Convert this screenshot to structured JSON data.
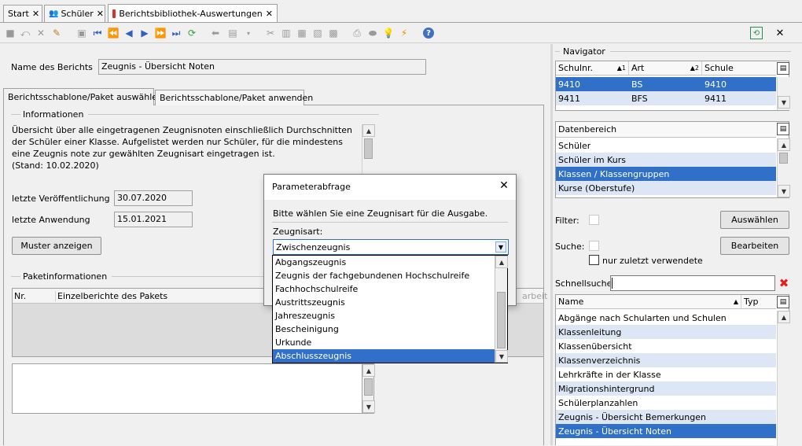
{
  "tabs": [
    {
      "label": "Start"
    },
    {
      "label": "Schüler"
    },
    {
      "label": "Berichtsbibliothek-Auswertungen"
    }
  ],
  "report": {
    "name_label": "Name des Berichts",
    "name_value": "Zeugnis - Übersicht Noten"
  },
  "subtabs": [
    {
      "label": "Berichtsschablone/Paket auswählen"
    },
    {
      "label": "Berichtsschablone/Paket anwenden"
    }
  ],
  "info": {
    "group_label": "Informationen",
    "text": "Übersicht über alle eingetragenen Zeugnisnoten einschließlich Durchschnitten der Schüler einer Klasse. Aufgelistet werden nur Schüler, für die mindestens eine Zeugnis note zur gewählten Zeugnisart eingetragen ist.",
    "stand": "(Stand: 10.02.2020)"
  },
  "published": {
    "label": "letzte Veröffentlichung",
    "value": "30.07.2020"
  },
  "applied": {
    "label": "letzte Anwendung",
    "value": "15.01.2021"
  },
  "muster_button": "Muster anzeigen",
  "package": {
    "group_label": "Paketinformationen",
    "col_nr": "Nr.",
    "col_reports": "Einzelberichte des Pakets",
    "hidden_label": "arbeit"
  },
  "navigator": {
    "title": "Navigator",
    "cols": {
      "schulnr": "Schulnr.",
      "art": "Art",
      "schule": "Schule",
      "sort1": "1",
      "sort2": "2"
    },
    "rows": [
      {
        "schulnr": "9410",
        "art": "BS",
        "schule": "9410"
      },
      {
        "schulnr": "9411",
        "art": "BFS",
        "schule": "9411"
      }
    ]
  },
  "datenbereich": {
    "title": "Datenbereich",
    "items": [
      "Schüler",
      "Schüler im Kurs",
      "Klassen / Klassengruppen",
      "Kurse (Oberstufe)"
    ]
  },
  "filter": {
    "label": "Filter:",
    "button": "Auswählen"
  },
  "suche": {
    "label": "Suche:",
    "button": "Bearbeiten",
    "recent_label": "nur zuletzt verwendete"
  },
  "schnellsuche": {
    "label": "Schnellsuche",
    "value": ""
  },
  "reportlist": {
    "col_name": "Name",
    "col_typ": "Typ",
    "items": [
      "Abgänge nach Schularten und Schulen",
      "Klassenleitung",
      "Klassenübersicht",
      "Klassenverzeichnis",
      "Lehrkräfte in der Klasse",
      "Migrationshintergrund",
      "Schülerplanzahlen",
      "Zeugnis - Übersicht Bemerkungen",
      "Zeugnis - Übersicht Noten"
    ]
  },
  "dialog": {
    "title": "Parameterabfrage",
    "prompt": "Bitte wählen Sie eine Zeugnisart für die Ausgabe.",
    "field_label": "Zeugnisart:",
    "selected": "Zwischenzeugnis",
    "options": [
      "Abgangszeugnis",
      "Zeugnis der fachgebundenen Hochschulreife",
      "Fachhochschulreife",
      "Austrittszeugnis",
      "Jahreszeugnis",
      "Bescheinigung",
      "Urkunde",
      "Abschlusszeugnis"
    ]
  },
  "colors": {
    "selection": "#3170c8",
    "alt_row": "#dce6f4",
    "accent_icon": "#2e8b57"
  }
}
